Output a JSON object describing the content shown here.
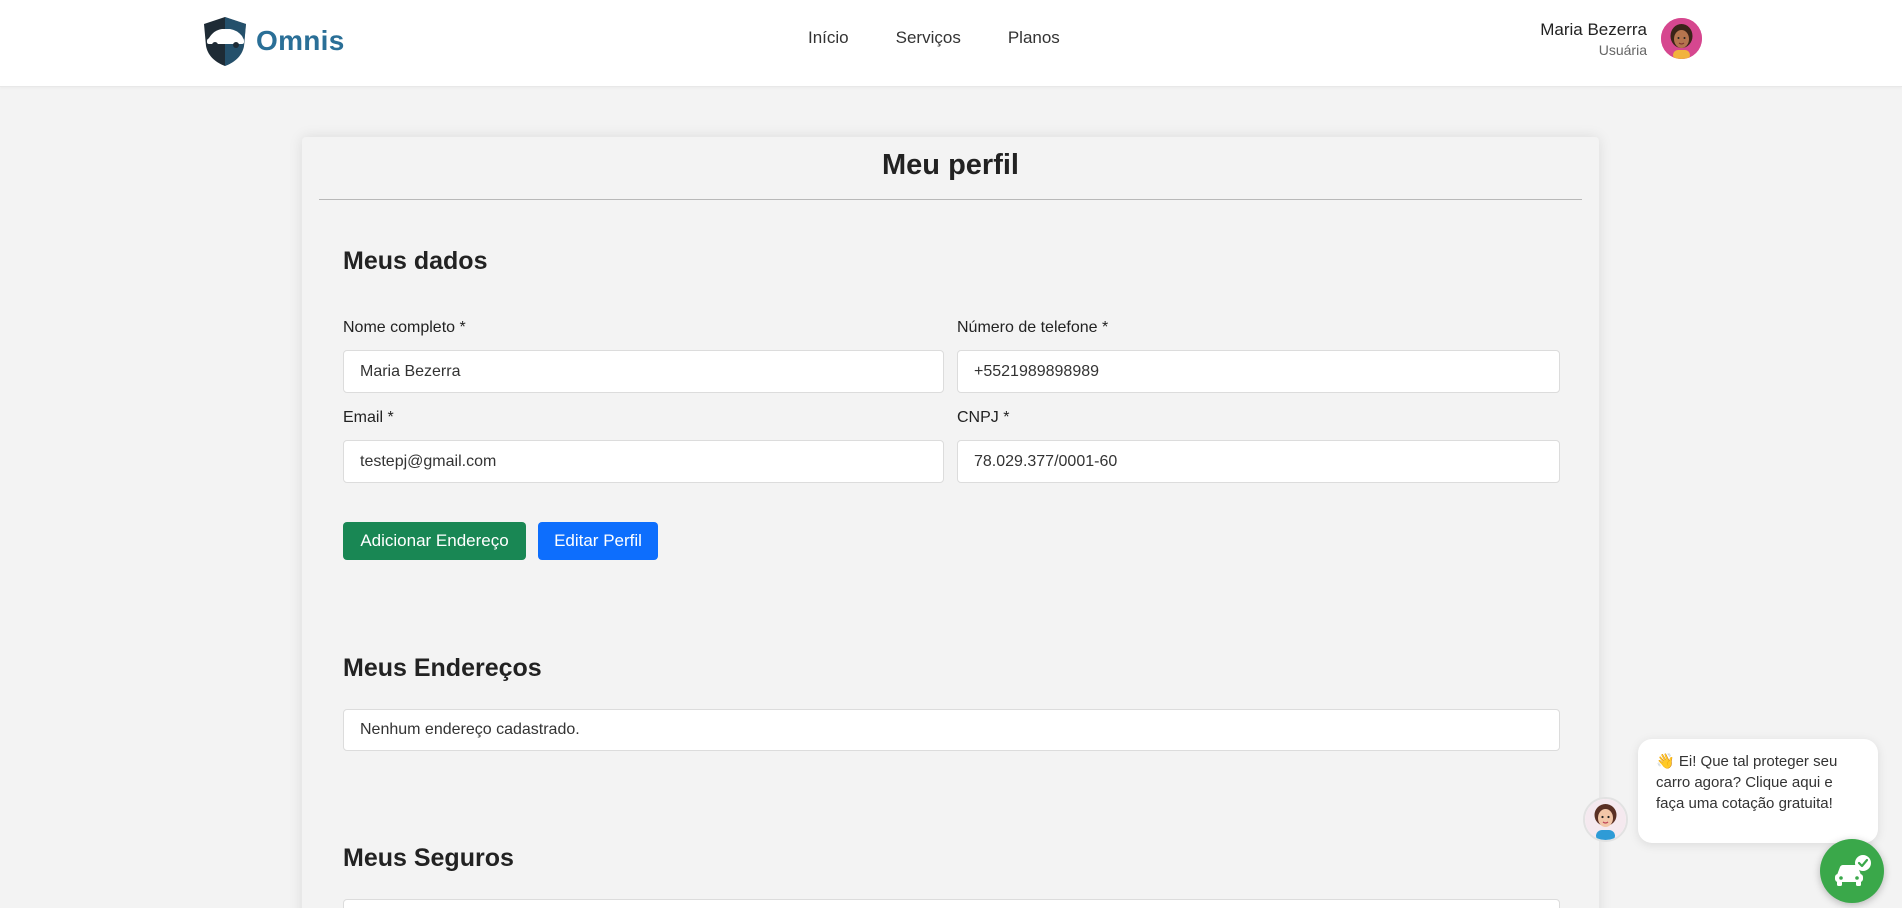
{
  "header": {
    "brand": "Omnis",
    "nav": [
      {
        "label": "Início"
      },
      {
        "label": "Serviços"
      },
      {
        "label": "Planos"
      }
    ],
    "user": {
      "name": "Maria Bezerra",
      "role": "Usuária"
    }
  },
  "profile": {
    "title": "Meu perfil",
    "data_section": {
      "title": "Meus dados",
      "fields": {
        "name": {
          "label": "Nome completo *",
          "value": "Maria Bezerra"
        },
        "phone": {
          "label": "Número de telefone *",
          "value": "+5521989898989"
        },
        "email": {
          "label": "Email *",
          "value": "testepj@gmail.com"
        },
        "cnpj": {
          "label": "CNPJ *",
          "value": "78.029.377/0001-60"
        }
      },
      "buttons": {
        "add_address": "Adicionar Endereço",
        "edit_profile": "Editar Perfil"
      }
    },
    "addresses_section": {
      "title": "Meus Endereços",
      "empty_text": "Nenhum endereço cadastrado."
    },
    "insurances_section": {
      "title": "Meus Seguros"
    }
  },
  "chat": {
    "emoji": "👋",
    "message": "Ei! Que tal proteger seu carro agora? Clique aqui e faça uma cotação gratuita!"
  },
  "colors": {
    "brand": "#2a6f97",
    "green_button": "#198754",
    "blue_button": "#0d6efd",
    "fab": "#3aa84a"
  }
}
